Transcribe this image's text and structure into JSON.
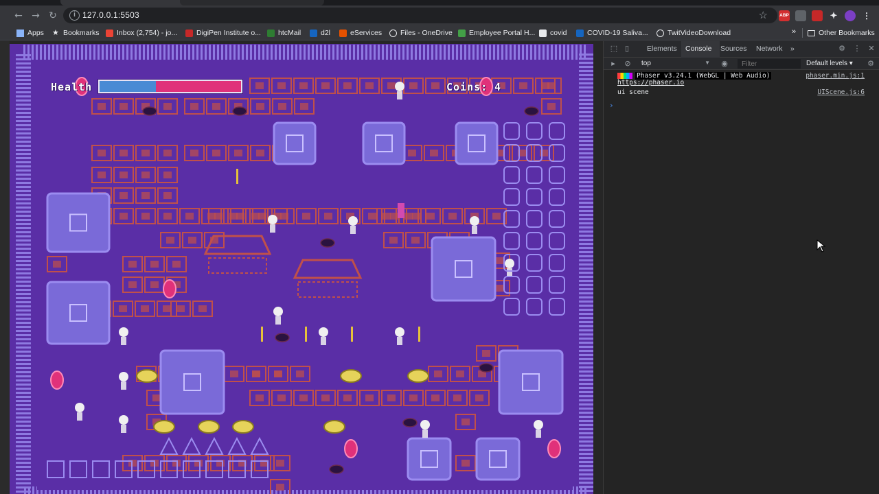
{
  "browser": {
    "url": "127.0.0.1:5503",
    "bookmarks": [
      {
        "label": "Apps",
        "color": "#8ab4f8"
      },
      {
        "label": "Bookmarks",
        "color": "#e8eaed"
      },
      {
        "label": "Inbox (2,754) - jo...",
        "color": "#ea4335"
      },
      {
        "label": "DigiPen Institute o...",
        "color": "#c62828"
      },
      {
        "label": "htcMail",
        "color": "#2e7d32"
      },
      {
        "label": "d2l",
        "color": "#1565c0"
      },
      {
        "label": "eServices",
        "color": "#e65100"
      },
      {
        "label": "Files - OneDrive",
        "color": "#e8eaed"
      },
      {
        "label": "Employee Portal H...",
        "color": "#43a047"
      },
      {
        "label": "covid",
        "color": "#e8eaed"
      },
      {
        "label": "COVID-19 Saliva...",
        "color": "#1565c0"
      },
      {
        "label": "TwitVideoDownload",
        "color": "#e8eaed"
      }
    ],
    "more_label": "»",
    "other_bookmarks": "Other Bookmarks",
    "extensions": [
      "ABP",
      "",
      "",
      "",
      ""
    ]
  },
  "game": {
    "health_label": "Health",
    "health_fraction": 0.4,
    "coins_label": "Coins:",
    "coins_value": "4",
    "colors": {
      "floor": "#5a2ea6",
      "brick": "#c0504a",
      "stone": "#7a6ad8",
      "wall_light": "#9b8cf0",
      "gem": "#e0317a",
      "slime": "#e6d35a",
      "skeleton": "#f0f0f0"
    }
  },
  "devtools": {
    "tabs": [
      "Elements",
      "Console",
      "Sources",
      "Network"
    ],
    "active_tab": "Console",
    "more_tabs": "»",
    "context": "top",
    "filter_placeholder": "Filter",
    "levels": "Default levels ▾",
    "logs": [
      {
        "text": "Phaser v3.24.1 (WebGL | Web Audio)",
        "sub": "https://phaser.io",
        "source": "phaser.min.js:1"
      },
      {
        "text": "ui scene",
        "sub": "",
        "source": "UIScene.js:6"
      }
    ],
    "prompt": "›"
  }
}
